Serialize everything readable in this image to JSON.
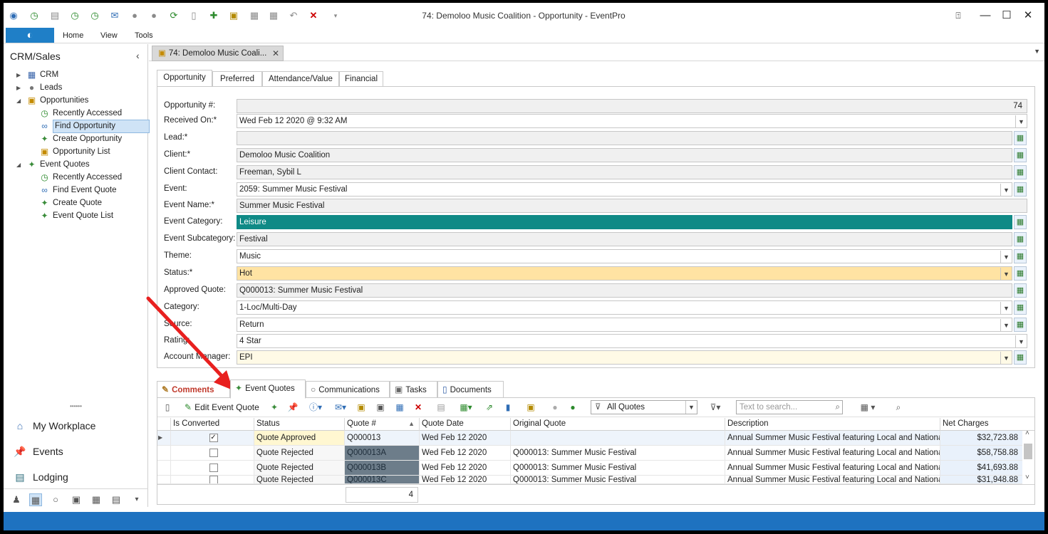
{
  "window": {
    "title": "74: Demoloo Music Coalition - Opportunity - EventPro",
    "controls": [
      "restore-icon",
      "minimize-icon",
      "maximize-icon",
      "close-icon"
    ]
  },
  "quick_access": [
    "refresh-icon",
    "recent-icon",
    "document-icon",
    "clock-icon",
    "clock2-icon",
    "mail-icon",
    "up-icon",
    "down-icon",
    "reload-icon",
    "add-icon",
    "clipboard-icon",
    "save-icon",
    "save-all-icon",
    "undo-icon",
    "delete-icon",
    "customize-icon"
  ],
  "ribbon": {
    "tabs": [
      "Home",
      "View",
      "Tools"
    ]
  },
  "left_panel": {
    "title": "CRM/Sales",
    "tree": [
      {
        "label": "CRM"
      },
      {
        "label": "Leads"
      },
      {
        "label": "Opportunities"
      },
      {
        "label": "Recently Accessed"
      },
      {
        "label": "Find Opportunity"
      },
      {
        "label": "Create Opportunity"
      },
      {
        "label": "Opportunity List"
      },
      {
        "label": "Event Quotes"
      },
      {
        "label": "Recently Accessed"
      },
      {
        "label": "Find Event Quote"
      },
      {
        "label": "Create Quote"
      },
      {
        "label": "Event Quote List"
      }
    ],
    "nav_buttons": [
      "My Workplace",
      "Events",
      "Lodging"
    ]
  },
  "doc_tab": {
    "label": "74: Demoloo Music Coali..."
  },
  "form_tabs": [
    "Opportunity",
    "Preferred",
    "Attendance/Value",
    "Financial"
  ],
  "fields": [
    {
      "label": "Opportunity #:",
      "value": "74"
    },
    {
      "label": "Received On:*",
      "value": "Wed Feb 12 2020 @ 9:32 AM"
    },
    {
      "label": "Lead:*",
      "value": ""
    },
    {
      "label": "Client:*",
      "value": "Demoloo Music Coalition"
    },
    {
      "label": "Client Contact:",
      "value": "Freeman, Sybil L"
    },
    {
      "label": "Event:",
      "value": "2059: Summer Music Festival"
    },
    {
      "label": "Event Name:*",
      "value": "Summer Music Festival"
    },
    {
      "label": "Event Category:",
      "value": "Leisure"
    },
    {
      "label": "Event Subcategory:",
      "value": "Festival"
    },
    {
      "label": "Theme:",
      "value": "Music"
    },
    {
      "label": "Status:*",
      "value": "Hot"
    },
    {
      "label": "Approved Quote:",
      "value": "Q000013: Summer Music Festival"
    },
    {
      "label": "Category:",
      "value": "1-Loc/Multi-Day"
    },
    {
      "label": "Source:",
      "value": "Return"
    },
    {
      "label": "Rating:",
      "value": "4 Star"
    },
    {
      "label": "Account Manager:",
      "value": "EPI"
    }
  ],
  "bottom_tabs": [
    "Comments",
    "Event Quotes",
    "Communications",
    "Tasks",
    "Documents"
  ],
  "grid_toolbar": {
    "edit_label": "Edit Event Quote",
    "filter": "All Quotes",
    "search_placeholder": "Text to search..."
  },
  "grid": {
    "columns": [
      "Is Converted",
      "Status",
      "Quote #",
      "Quote Date",
      "Original Quote",
      "Description",
      "Net Charges"
    ],
    "rows": [
      {
        "converted": "✓",
        "status": "Quote Approved",
        "quote": "Q000013",
        "date": "Wed Feb 12 2020",
        "original": "",
        "description": "Annual Summer Music Festival featuring Local and National ...",
        "net": "$32,723.88"
      },
      {
        "converted": "",
        "status": "Quote Rejected",
        "quote": "Q000013A",
        "date": "Wed Feb 12 2020",
        "original": "Q000013: Summer Music Festival",
        "description": "Annual Summer Music Festival featuring Local and National ...",
        "net": "$58,758.88"
      },
      {
        "converted": "",
        "status": "Quote Rejected",
        "quote": "Q000013B",
        "date": "Wed Feb 12 2020",
        "original": "Q000013: Summer Music Festival",
        "description": "Annual Summer Music Festival featuring Local and National ...",
        "net": "$41,693.88"
      },
      {
        "converted": "",
        "status": "Quote Rejected",
        "quote": "Q000013C",
        "date": "Wed Feb 12 2020",
        "original": "Q000013: Summer Music Festival",
        "description": "Annual Summer Music Festival featuring Local and National ...",
        "net": "$31,948.88"
      }
    ],
    "count": "4"
  },
  "colors": {
    "accent": "#1e72c0",
    "teal": "#0f8a86",
    "hot": "#ffe3a3",
    "arrow": "#e8201f"
  }
}
